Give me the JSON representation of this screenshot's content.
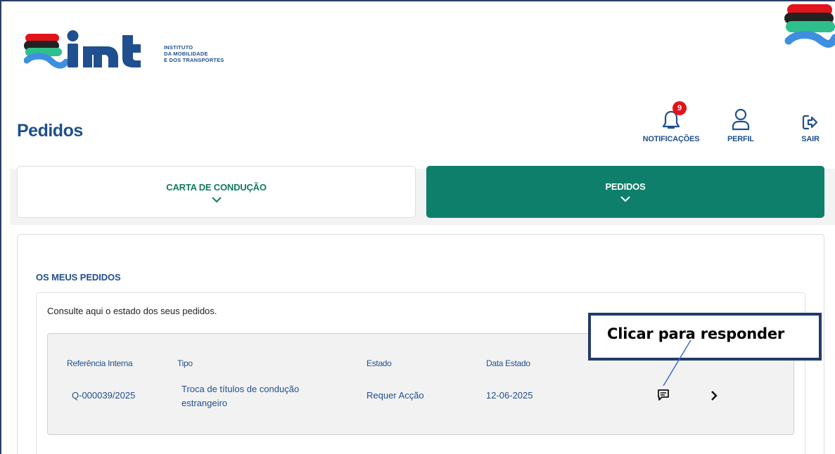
{
  "brand": {
    "logo_text": "imt",
    "subtitle_lines": [
      "INSTITUTO",
      "DA MOBILIDADE",
      "E DOS TRANSPORTES"
    ],
    "colors": {
      "red": "#e3131b",
      "green": "#2fbf8c",
      "blue": "#1f4f8f",
      "dark": "#222222"
    }
  },
  "page": {
    "title": "Pedidos"
  },
  "header_actions": {
    "notifications": {
      "label": "NOTIFICAÇÕES",
      "badge": "9",
      "icon": "bell-icon"
    },
    "profile": {
      "label": "PERFIL",
      "icon": "user-icon"
    },
    "logout": {
      "label": "SAIR",
      "icon": "logout-icon"
    }
  },
  "tabs": [
    {
      "label": "CARTA DE CONDUÇÃO",
      "active": false
    },
    {
      "label": "PEDIDOS",
      "active": true
    }
  ],
  "section": {
    "title": "OS MEUS PEDIDOS",
    "description": "Consulte aqui o estado dos seus pedidos."
  },
  "table": {
    "columns": [
      "Referência Interna",
      "Tipo",
      "Estado",
      "Data Estado"
    ],
    "rows": [
      {
        "reference": "Q-000039/2025",
        "type": "Troca de títulos de condução estrangeiro",
        "status": "Requer Acção",
        "date": "12-06-2025",
        "actions": [
          "message-icon",
          "chevron-right-icon"
        ]
      }
    ]
  },
  "annotation": {
    "text": "Clicar para responder"
  },
  "accent_colors": {
    "primary_blue": "#1f4f8f",
    "teal": "#0e7f6a",
    "tab_text_green": "#127a5f",
    "callout_border": "#233a6e"
  }
}
